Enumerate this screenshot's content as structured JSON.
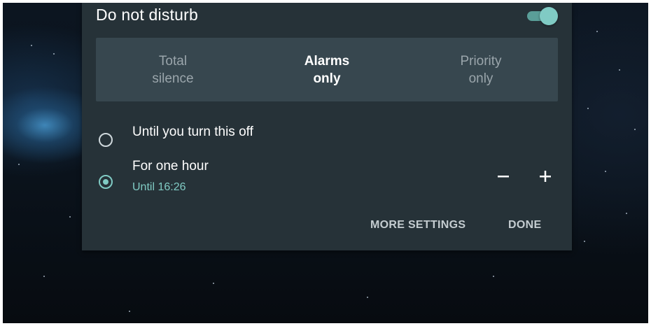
{
  "dialog": {
    "title": "Do not disturb",
    "toggle_on": true,
    "accent_color": "#80cbc4",
    "modes": [
      {
        "line1": "Total",
        "line2": "silence",
        "selected": false
      },
      {
        "line1": "Alarms",
        "line2": "only",
        "selected": true
      },
      {
        "line1": "Priority",
        "line2": "only",
        "selected": false
      }
    ],
    "options": [
      {
        "label": "Until you turn this off",
        "checked": false
      },
      {
        "label": "For one hour",
        "sublabel": "Until 16:26",
        "checked": true
      }
    ],
    "stepper": {
      "decrease_icon": "minus-icon",
      "increase_icon": "plus-icon"
    },
    "actions": {
      "more_settings": "MORE SETTINGS",
      "done": "DONE"
    }
  }
}
